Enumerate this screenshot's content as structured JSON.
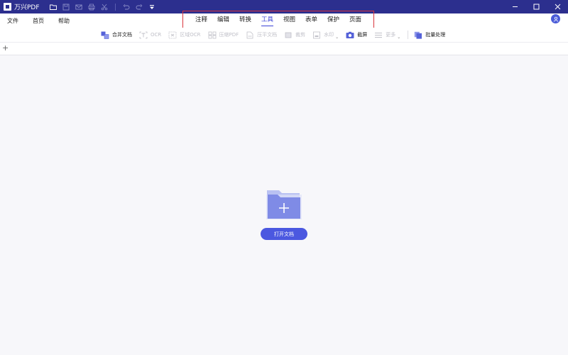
{
  "titlebar": {
    "app_name": "万兴PDF",
    "icons": [
      "folder-icon",
      "save-icon",
      "mail-icon",
      "print-icon",
      "cut-icon",
      "undo-icon",
      "redo-icon",
      "dropdown-arrow-icon"
    ],
    "window_controls": [
      "minimize-icon",
      "maximize-icon",
      "close-icon"
    ]
  },
  "menu": {
    "items": [
      "文件",
      "首页",
      "帮助"
    ]
  },
  "tabs": {
    "items": [
      "注释",
      "编辑",
      "转换",
      "工具",
      "视图",
      "表单",
      "保护",
      "页面"
    ],
    "active": "工具"
  },
  "toolbar": {
    "tools": [
      {
        "label": "合并文档",
        "icon": "merge-icon",
        "enabled": true
      },
      {
        "label": "OCR",
        "icon": "ocr-icon",
        "enabled": false
      },
      {
        "label": "区域OCR",
        "icon": "area-ocr-icon",
        "enabled": false
      },
      {
        "label": "压缩PDF",
        "icon": "compress-icon",
        "enabled": false
      },
      {
        "label": "压平文档",
        "icon": "flatten-icon",
        "enabled": false
      },
      {
        "label": "裁剪",
        "icon": "crop-icon",
        "enabled": false
      },
      {
        "label": "水印",
        "icon": "watermark-icon",
        "enabled": false,
        "has_dropdown": true
      },
      {
        "label": "截屏",
        "icon": "screenshot-icon",
        "enabled": true
      },
      {
        "label": "更多",
        "icon": "more-icon",
        "enabled": false,
        "has_dropdown": true
      },
      {
        "label": "批量处理",
        "icon": "batch-icon",
        "enabled": true
      }
    ]
  },
  "docstrip": {
    "add_symbol": "+"
  },
  "main": {
    "open_button_label": "打开文档"
  },
  "colors": {
    "titlebar_bg": "#2c2f8e",
    "accent": "#3a42d6",
    "highlight_box": "#d9353c",
    "button": "#4b58e0"
  }
}
